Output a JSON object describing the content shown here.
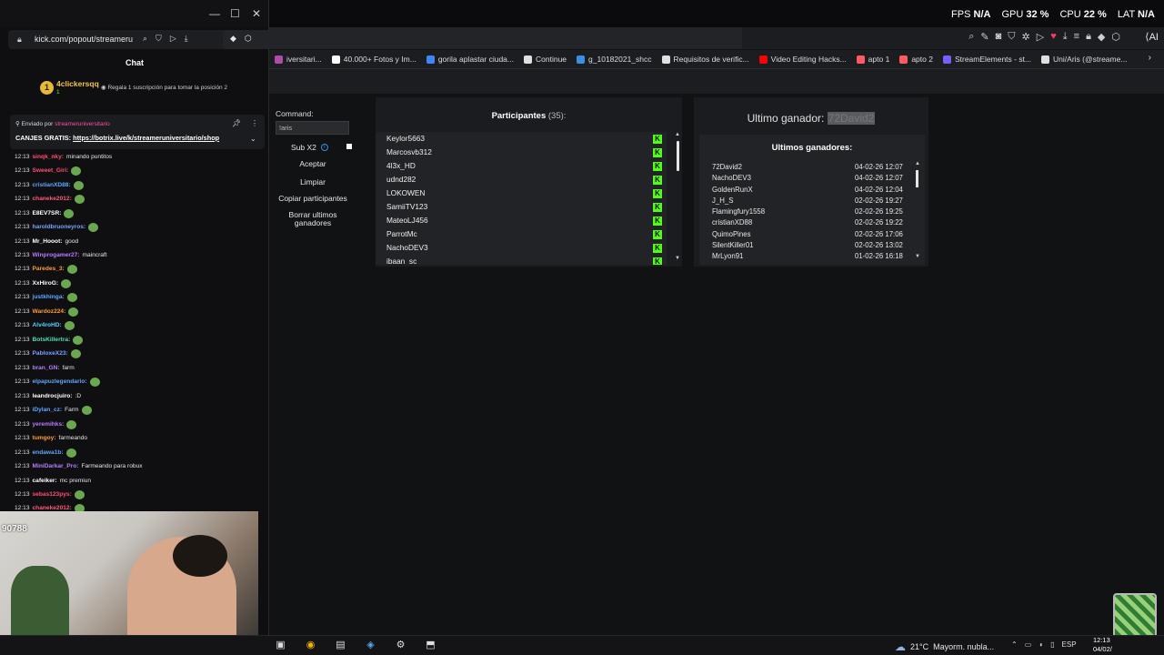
{
  "overlay": {
    "fps_label": "FPS",
    "fps_value": "N/A",
    "gpu_label": "GPU",
    "gpu_value": "32 %",
    "cpu_label": "CPU",
    "cpu_value": "22 %",
    "lat_label": "LAT",
    "lat_value": "N/A"
  },
  "browser": {
    "ai_label": "AI",
    "bookmarks": [
      {
        "label": "iversitari...",
        "color": "#b04ca8"
      },
      {
        "label": "40.000+ Fotos y Im...",
        "color": "#ffffff"
      },
      {
        "label": "gorila aplastar ciuda...",
        "color": "#4285f4"
      },
      {
        "label": "Continue",
        "color": "#e0e0e0"
      },
      {
        "label": "g_10182021_shcc",
        "color": "#3b8fe0"
      },
      {
        "label": "Requisitos de verific...",
        "color": "#e0e0e0"
      },
      {
        "label": "Video Editing Hacks...",
        "color": "#ff0000"
      },
      {
        "label": "apto 1",
        "color": "#ff5a5f"
      },
      {
        "label": "apto 2",
        "color": "#ff5a5f"
      },
      {
        "label": "StreamElements - st...",
        "color": "#7b5cff"
      },
      {
        "label": "Uni/Aris (@streame...",
        "color": "#e0e0e0"
      }
    ]
  },
  "giveaway": {
    "command_label": "Command:",
    "command_value": "!aris",
    "sub_label": "Sub X2",
    "buttons": {
      "accept": "Aceptar",
      "clear": "Limpiar",
      "copy": "Copiar participantes",
      "delete": "Borrar ultimos ganadores"
    },
    "participants_title": "Participantes",
    "participants_count": "(35):",
    "participants": [
      "Keylor5663",
      "Marcosvb312",
      "4l3x_HD",
      "udnd282",
      "LOKOWEN",
      "SamiiTV123",
      "MateoLJ456",
      "ParrotMc",
      "NachoDEV3",
      "ibaan_sc"
    ],
    "last_winner_label": "Ultimo ganador:",
    "last_winner_name": "72David2",
    "winners_title": "Ultimos ganadores:",
    "winners": [
      {
        "name": "72David2",
        "date": "04-02-26 12:07"
      },
      {
        "name": "NachoDEV3",
        "date": "04-02-26 12:07"
      },
      {
        "name": "GoldenRunX",
        "date": "04-02-26 12:04"
      },
      {
        "name": "J_H_S",
        "date": "02-02-26 19:27"
      },
      {
        "name": "Flamingfury1558",
        "date": "02-02-26 19:25"
      },
      {
        "name": "cristianXD88",
        "date": "02-02-26 19:22"
      },
      {
        "name": "QuimoPines",
        "date": "02-02-26 17:06"
      },
      {
        "name": "SilentKiller01",
        "date": "02-02-26 13:02"
      },
      {
        "name": "MrLyon91",
        "date": "01-02-26 16:18"
      }
    ]
  },
  "chat": {
    "url": "kick.com/popout/streameru",
    "title": "Chat",
    "leader_rank": "1",
    "leader_name": "4clickersqq",
    "leader_count": "1",
    "leader_message": "Regala 1 suscripción para tomar la posición 2",
    "pinned_by_label": "Enviado por",
    "pinned_by_user": "streameruniversitario",
    "pinned_text_prefix": "CANJES GRATIS:",
    "pinned_link": "https://botrix.live/k/streameruniversitario/shop",
    "messages": [
      {
        "ts": "12:13",
        "user": "sinqk_nky:",
        "color": "#ff4f6e",
        "text": "minando puntitos",
        "emote": false
      },
      {
        "ts": "12:13",
        "user": "Sweeet_Giri:",
        "color": "#ff4f6e",
        "text": "",
        "emote": true
      },
      {
        "ts": "12:13",
        "user": "cristianXD88:",
        "color": "#5fa8ff",
        "text": "",
        "emote": true
      },
      {
        "ts": "12:13",
        "user": "chaneke2012:",
        "color": "#ff5a7a",
        "text": "",
        "emote": true
      },
      {
        "ts": "12:13",
        "user": "E8EV7SR:",
        "color": "#ffffff",
        "text": "",
        "emote": true
      },
      {
        "ts": "12:13",
        "user": "haroldbruoneyros:",
        "color": "#7aa2ff",
        "text": "",
        "emote": true
      },
      {
        "ts": "12:13",
        "user": "Mr_Hooot:",
        "color": "#ffffff",
        "text": "good",
        "emote": false
      },
      {
        "ts": "12:13",
        "user": "Winprogamer27:",
        "color": "#b67cff",
        "text": "maincraft",
        "emote": false
      },
      {
        "ts": "12:13",
        "user": "Paredes_3:",
        "color": "#ff9a3c",
        "text": "",
        "emote": true
      },
      {
        "ts": "12:13",
        "user": "XxHiroG:",
        "color": "#ffffff",
        "text": "",
        "emote": true
      },
      {
        "ts": "12:13",
        "user": "justkhinga:",
        "color": "#5fa8ff",
        "text": "",
        "emote": true
      },
      {
        "ts": "12:13",
        "user": "Wardoz224:",
        "color": "#ff9a3c",
        "text": "",
        "emote": true
      },
      {
        "ts": "12:13",
        "user": "Alv4roHD:",
        "color": "#58d1ff",
        "text": "",
        "emote": true
      },
      {
        "ts": "12:13",
        "user": "BotsKillertra:",
        "color": "#52e0b0",
        "text": "",
        "emote": true
      },
      {
        "ts": "12:13",
        "user": "PabloxeX23:",
        "color": "#7aa2ff",
        "text": "",
        "emote": true
      },
      {
        "ts": "12:13",
        "user": "bran_GN:",
        "color": "#b67cff",
        "text": "farm",
        "emote": false
      },
      {
        "ts": "12:13",
        "user": "elpapuzlegendario:",
        "color": "#5fa8ff",
        "text": "",
        "emote": true
      },
      {
        "ts": "12:13",
        "user": "leandrocjuiro:",
        "color": "#ffffff",
        "text": ":D",
        "emote": false
      },
      {
        "ts": "12:13",
        "user": "iDylan_cz:",
        "color": "#5fa8ff",
        "text": "Farm",
        "emote": true
      },
      {
        "ts": "12:13",
        "user": "yeremihks:",
        "color": "#b67cff",
        "text": "",
        "emote": true
      },
      {
        "ts": "12:13",
        "user": "tumgoy:",
        "color": "#ff9a3c",
        "text": "farmeando",
        "emote": false
      },
      {
        "ts": "12:13",
        "user": "endawa1b:",
        "color": "#5fa8ff",
        "text": "",
        "emote": true
      },
      {
        "ts": "12:13",
        "user": "MiniDarkar_Pro:",
        "color": "#b67cff",
        "text": "Farmeando para robux",
        "emote": false
      },
      {
        "ts": "12:13",
        "user": "cafeiker:",
        "color": "#ffffff",
        "text": "mc premiun",
        "emote": false
      },
      {
        "ts": "12:13",
        "user": "sebas123pys:",
        "color": "#ff4f6e",
        "text": "",
        "emote": true
      },
      {
        "ts": "12:13",
        "user": "chaneke2012:",
        "color": "#ff5a7a",
        "text": "",
        "emote": true
      }
    ]
  },
  "webcam": {
    "counter": "90788"
  },
  "taskbar": {
    "temperature": "21°C",
    "weather_text": "Mayorm. nubla...",
    "language": "ESP",
    "time": "12:13",
    "date": "04/02/"
  }
}
